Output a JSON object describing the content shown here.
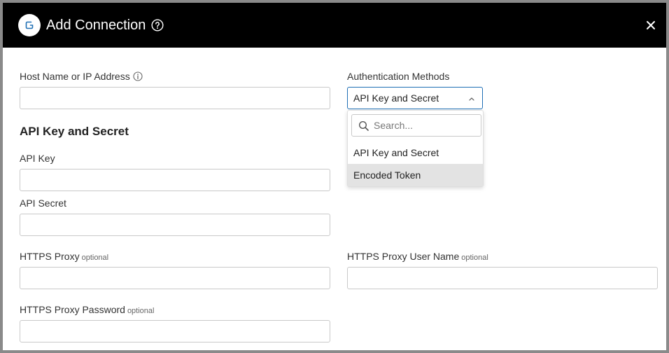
{
  "dialog": {
    "title": "Add Connection",
    "close_icon": "close-icon",
    "help_icon": "help-icon",
    "logo_icon": "connector-logo-icon"
  },
  "form": {
    "host": {
      "label": "Host Name or IP Address",
      "value": "",
      "info_icon": "info-icon"
    },
    "auth": {
      "label": "Authentication Methods",
      "selected": "API Key and Secret",
      "search_placeholder": "Search...",
      "options": [
        "API Key and Secret",
        "Encoded Token"
      ],
      "highlighted_option": "Encoded Token"
    },
    "section_title": "API Key and Secret",
    "api_key": {
      "label": "API Key",
      "value": ""
    },
    "api_secret": {
      "label": "API Secret",
      "value": ""
    },
    "proxy": {
      "label": "HTTPS Proxy",
      "optional": "optional",
      "value": ""
    },
    "proxy_user": {
      "label": "HTTPS Proxy User Name",
      "optional": "optional",
      "value": ""
    },
    "proxy_password": {
      "label": "HTTPS Proxy Password",
      "optional": "optional",
      "value": ""
    }
  },
  "colors": {
    "header_bg": "#000000",
    "focus_border": "#1f6fb5",
    "option_hover": "#e3e3e3"
  }
}
